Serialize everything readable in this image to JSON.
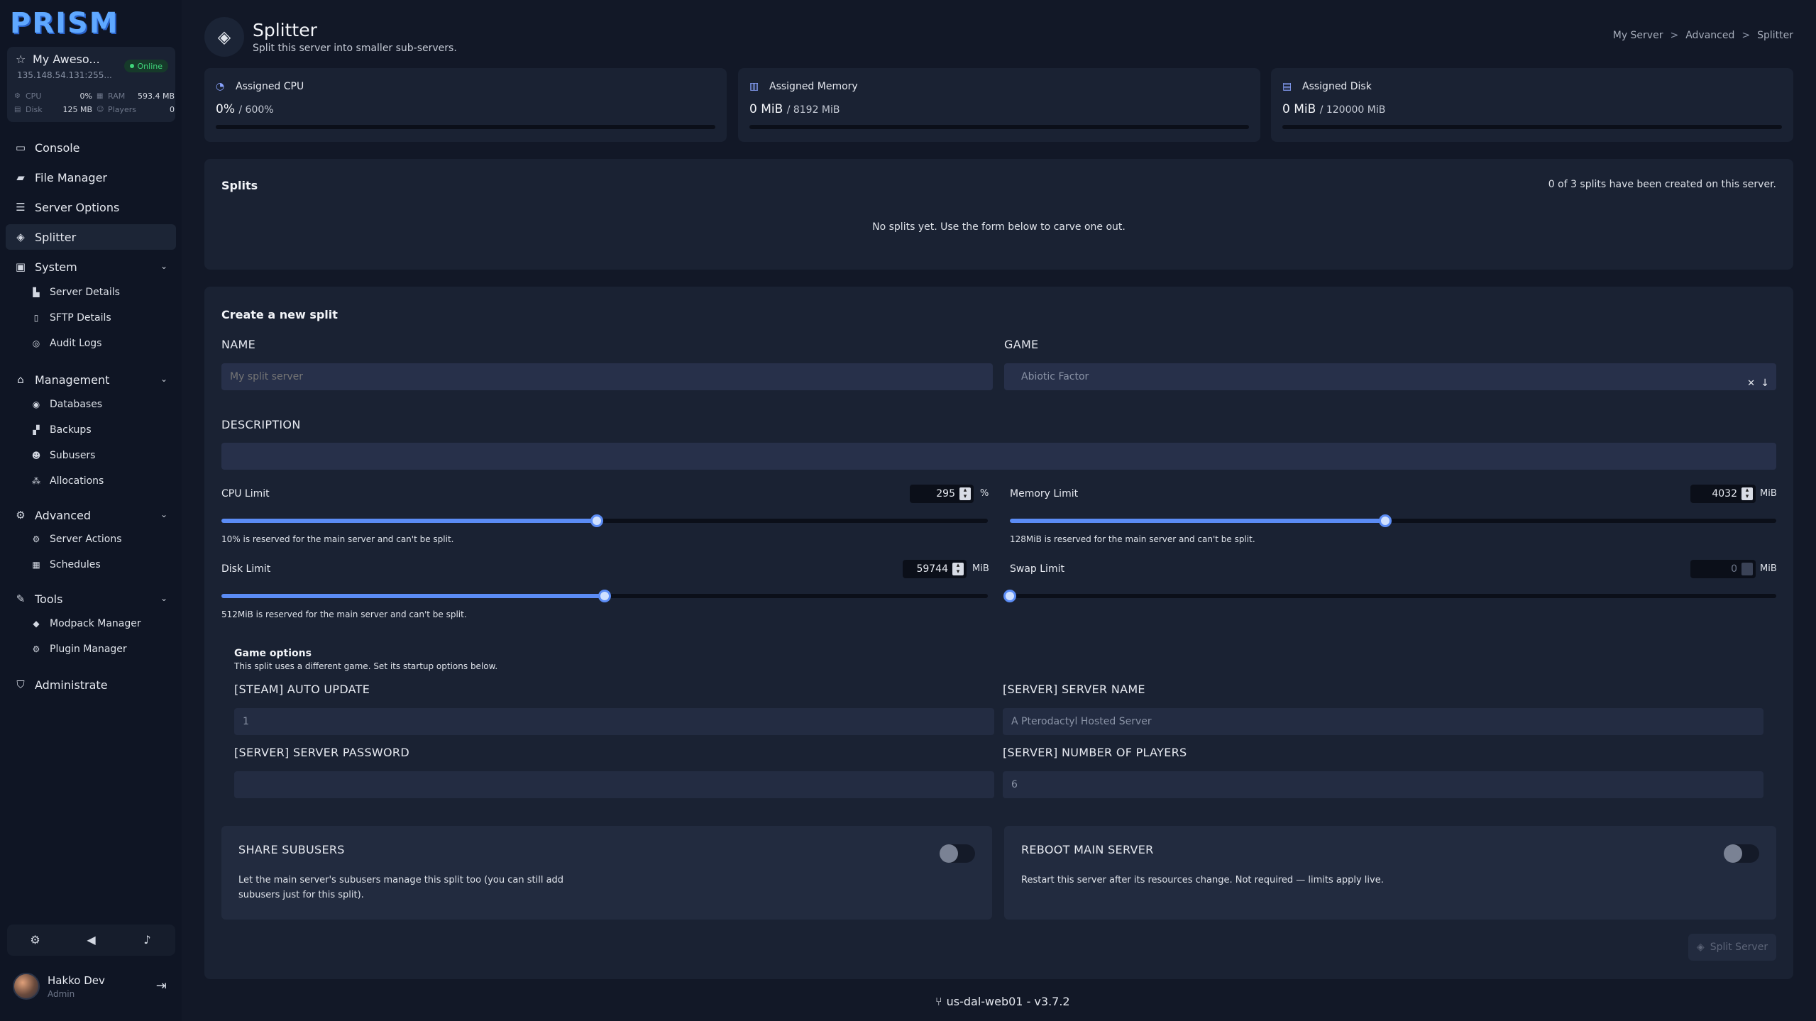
{
  "app": {
    "logo": "PRISM"
  },
  "server": {
    "name": "My Aweso...",
    "status": "Online",
    "ip": "135.148.54.131:255...",
    "stats": {
      "cpu_label": "CPU",
      "cpu_value": "0%",
      "ram_label": "RAM",
      "ram_value": "593.4 MB",
      "disk_label": "Disk",
      "disk_value": "125 MB",
      "players_label": "Players",
      "players_value": "0"
    }
  },
  "nav": {
    "console": "Console",
    "file_manager": "File Manager",
    "server_options": "Server Options",
    "splitter": "Splitter",
    "system": "System",
    "server_details": "Server Details",
    "sftp_details": "SFTP Details",
    "audit_logs": "Audit Logs",
    "management": "Management",
    "databases": "Databases",
    "backups": "Backups",
    "subusers": "Subusers",
    "allocations": "Allocations",
    "advanced": "Advanced",
    "server_actions": "Server Actions",
    "schedules": "Schedules",
    "tools": "Tools",
    "modpack_manager": "Modpack Manager",
    "plugin_manager": "Plugin Manager",
    "administrate": "Administrate"
  },
  "user": {
    "name": "Hakko Dev",
    "role": "Admin"
  },
  "header": {
    "title": "Splitter",
    "subtitle": "Split this server into smaller sub-servers.",
    "breadcrumb": [
      "My Server",
      ">",
      "Advanced",
      ">",
      "Splitter"
    ]
  },
  "assigned": {
    "cpu": {
      "title": "Assigned CPU",
      "value": "0%",
      "of": "/ 600%",
      "percent": 0
    },
    "memory": {
      "title": "Assigned Memory",
      "value": "0 MiB",
      "of": "/ 8192 MiB",
      "percent": 0
    },
    "disk": {
      "title": "Assigned Disk",
      "value": "0 MiB",
      "of": "/ 120000 MiB",
      "percent": 0
    }
  },
  "splits": {
    "title": "Splits",
    "count_text": "0 of 3 splits have been created on this server.",
    "empty_text": "No splits yet. Use the form below to carve one out."
  },
  "form": {
    "title": "Create a new split",
    "name_label": "NAME",
    "name_placeholder": "My split server",
    "game_label": "GAME",
    "game_value": "Abiotic Factor",
    "description_label": "DESCRIPTION",
    "cpu": {
      "label": "CPU Limit",
      "value": "295",
      "unit": "%",
      "fraction": 0.49,
      "hint": "10% is reserved for the main server and can't be split."
    },
    "memory": {
      "label": "Memory Limit",
      "value": "4032",
      "unit": "MiB",
      "fraction": 0.49,
      "hint": "128MiB is reserved for the main server and can't be split."
    },
    "disk": {
      "label": "Disk Limit",
      "value": "59744",
      "unit": "MiB",
      "fraction": 0.5,
      "hint": "512MiB is reserved for the main server and can't be split."
    },
    "swap": {
      "label": "Swap Limit",
      "value": "0",
      "unit": "MiB",
      "fraction": 0
    },
    "game_options_title": "Game options",
    "game_options_sub": "This split uses a different game. Set its startup options below.",
    "steam_auto_update_label": "[STEAM] AUTO UPDATE",
    "steam_auto_update_value": "1",
    "server_name_label": "[SERVER] SERVER NAME",
    "server_name_value": "A Pterodactyl Hosted Server",
    "server_password_label": "[SERVER] SERVER PASSWORD",
    "server_password_value": "",
    "num_players_label": "[SERVER] NUMBER OF PLAYERS",
    "num_players_value": "6",
    "share_subusers_title": "SHARE SUBUSERS",
    "share_subusers_desc": "Let the main server's subusers manage this split too (you can still add subusers just for this split).",
    "reboot_title": "REBOOT MAIN SERVER",
    "reboot_desc": "Restart this server after its resources change. Not required — limits apply live.",
    "submit_label": "Split Server"
  },
  "footer": {
    "version": "us-dal-web01 - v3.7.2"
  },
  "colors": {
    "accent": "#5b8cf5",
    "online": "#3fd47a",
    "background": "#121827",
    "panel": "#1a2233"
  }
}
